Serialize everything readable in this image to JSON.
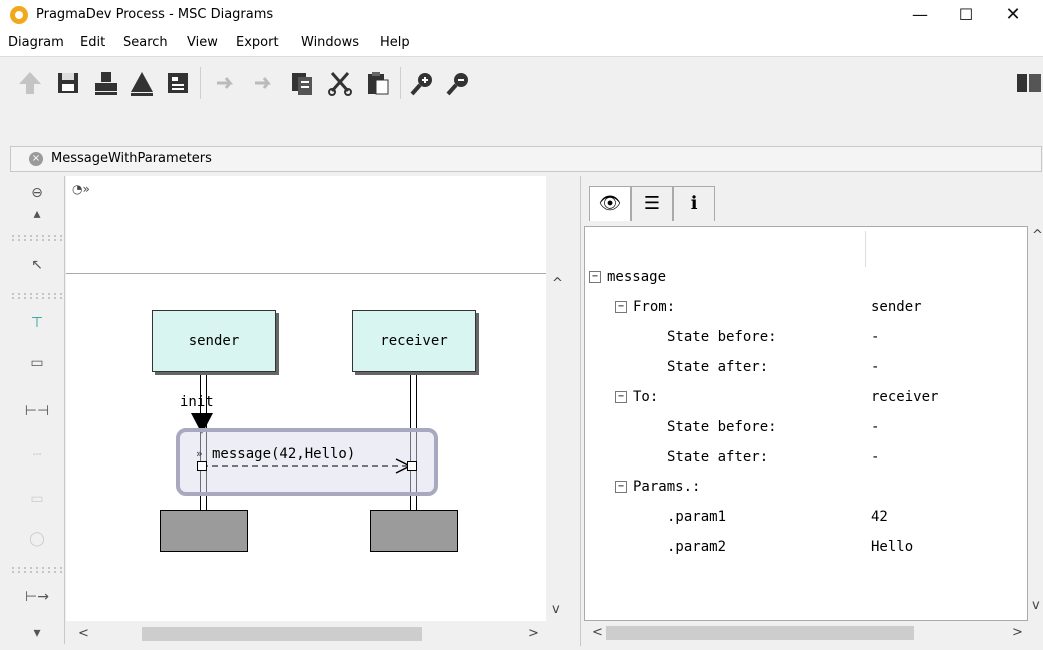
{
  "window": {
    "title": "PragmaDev Process - MSC Diagrams",
    "min": "—",
    "max": "☐",
    "close": "✕"
  },
  "menu": [
    "Diagram",
    "Edit",
    "Search",
    "View",
    "Export",
    "Windows",
    "Help"
  ],
  "tab": {
    "label": "MessageWithParameters",
    "close_glyph": "×"
  },
  "diagram": {
    "lifelines": [
      "sender",
      "receiver"
    ],
    "init_label": "init",
    "message_label": "message(42,Hello)",
    "marker": "»"
  },
  "details": {
    "root": "message",
    "rows": [
      {
        "label": "From:",
        "value": "sender"
      },
      {
        "label": "State before:",
        "value": "-"
      },
      {
        "label": "State after:",
        "value": "-"
      },
      {
        "label": "To:",
        "value": "receiver"
      },
      {
        "label": "State before:",
        "value": "-"
      },
      {
        "label": "State after:",
        "value": "-"
      },
      {
        "label": "Params.:",
        "value": ""
      },
      {
        "label": ".param1",
        "value": "42"
      },
      {
        "label": ".param2",
        "value": "Hello"
      }
    ],
    "expander_glyph": "−"
  },
  "scroll": {
    "left": "<",
    "right": ">",
    "up": "^",
    "down": "v"
  },
  "colors": {
    "lifeline_fill": "#d9f5f2",
    "end_box": "#9b9b9b",
    "highlight": "#a8a8bf"
  }
}
